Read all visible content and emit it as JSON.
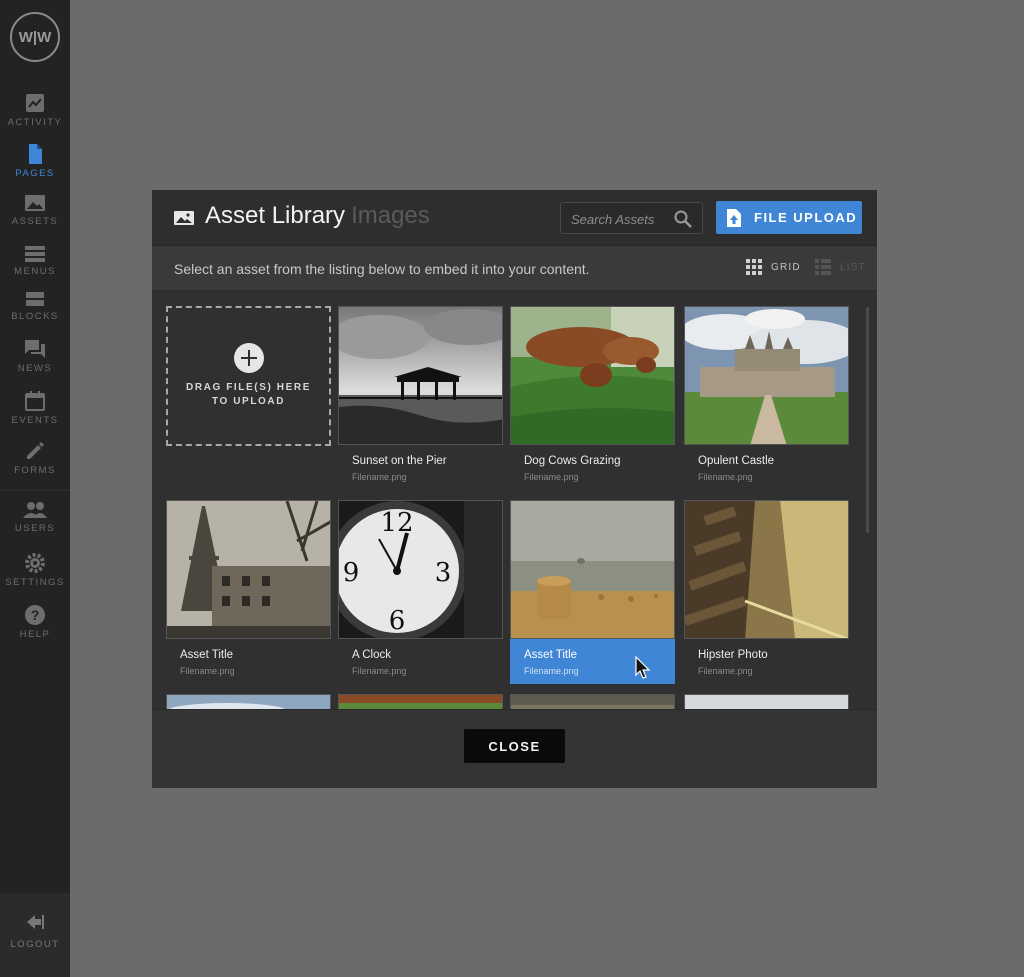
{
  "app": {
    "logo_text": "W|W"
  },
  "sidebar": {
    "items": [
      {
        "label": "ACTIVITY",
        "icon": "activity-chart-icon"
      },
      {
        "label": "PAGES",
        "icon": "page-document-icon",
        "active": true
      },
      {
        "label": "ASSETS",
        "icon": "image-icon"
      },
      {
        "label": "MENUS",
        "icon": "list-menu-icon"
      },
      {
        "label": "BLOCKS",
        "icon": "blocks-icon"
      },
      {
        "label": "NEWS",
        "icon": "chat-bubbles-icon"
      },
      {
        "label": "EVENTS",
        "icon": "calendar-icon"
      },
      {
        "label": "FORMS",
        "icon": "pencil-icon"
      },
      {
        "label": "USERS",
        "icon": "users-icon"
      },
      {
        "label": "SETTINGS",
        "icon": "gear-icon"
      },
      {
        "label": "HELP",
        "icon": "help-icon"
      }
    ],
    "logout_label": "LOGOUT"
  },
  "modal": {
    "title": "Asset Library",
    "subtitle": "Images",
    "search_placeholder": "Search Assets",
    "upload_label": "FILE UPLOAD",
    "info_text": "Select an asset from the listing below to embed it into your content.",
    "view_grid_label": "GRID",
    "view_list_label": "LIST",
    "dropzone_text": "DRAG FILE(S) HERE TO UPLOAD",
    "close_label": "CLOSE"
  },
  "assets": [
    {
      "title": "Sunset on the Pier",
      "filename": "Filename.png"
    },
    {
      "title": "Dog Cows Grazing",
      "filename": "Filename.png"
    },
    {
      "title": "Opulent Castle",
      "filename": "Filename.png"
    },
    {
      "title": "Asset Title",
      "filename": "Filename.png"
    },
    {
      "title": "A Clock",
      "filename": "Filename.png"
    },
    {
      "title": "Asset Title",
      "filename": "Filename.png",
      "selected": true
    },
    {
      "title": "Hipster Photo",
      "filename": "Filename.png"
    }
  ],
  "colors": {
    "accent": "#3f86d6",
    "sidebar_bg": "#232323",
    "overlay_bg": "#6b6b6b",
    "modal_bg": "#3a3a3a"
  }
}
